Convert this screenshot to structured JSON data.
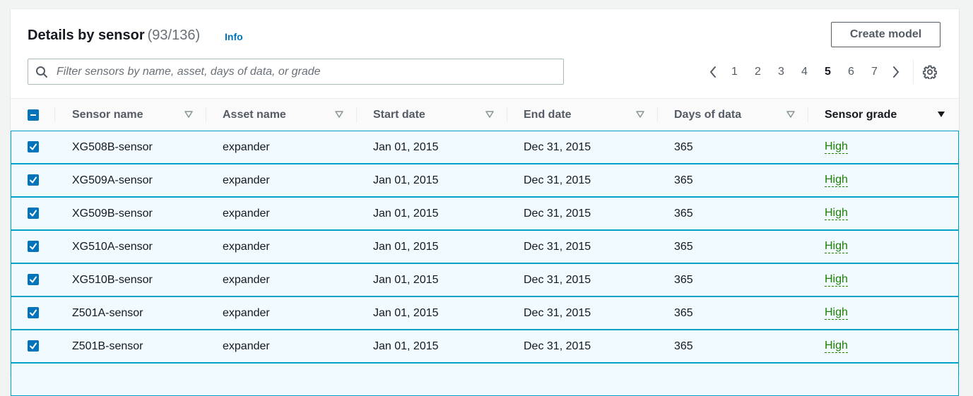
{
  "panel": {
    "title": "Details by sensor",
    "count": "(93/136)",
    "info_link": "Info",
    "create_button": "Create model"
  },
  "search": {
    "placeholder": "Filter sensors by name, asset, days of data, or grade"
  },
  "pagination": {
    "pages": [
      "1",
      "2",
      "3",
      "4",
      "5",
      "6",
      "7"
    ],
    "current_page": "5"
  },
  "table": {
    "columns": [
      "Sensor name",
      "Asset name",
      "Start date",
      "End date",
      "Days of data",
      "Sensor grade"
    ],
    "sorted_column": "Sensor grade",
    "rows": [
      {
        "sensor": "XG508B-sensor",
        "asset": "expander",
        "start": "Jan 01, 2015",
        "end": "Dec 31, 2015",
        "days": "365",
        "grade": "High"
      },
      {
        "sensor": "XG509A-sensor",
        "asset": "expander",
        "start": "Jan 01, 2015",
        "end": "Dec 31, 2015",
        "days": "365",
        "grade": "High"
      },
      {
        "sensor": "XG509B-sensor",
        "asset": "expander",
        "start": "Jan 01, 2015",
        "end": "Dec 31, 2015",
        "days": "365",
        "grade": "High"
      },
      {
        "sensor": "XG510A-sensor",
        "asset": "expander",
        "start": "Jan 01, 2015",
        "end": "Dec 31, 2015",
        "days": "365",
        "grade": "High"
      },
      {
        "sensor": "XG510B-sensor",
        "asset": "expander",
        "start": "Jan 01, 2015",
        "end": "Dec 31, 2015",
        "days": "365",
        "grade": "High"
      },
      {
        "sensor": "Z501A-sensor",
        "asset": "expander",
        "start": "Jan 01, 2015",
        "end": "Dec 31, 2015",
        "days": "365",
        "grade": "High"
      },
      {
        "sensor": "Z501B-sensor",
        "asset": "expander",
        "start": "Jan 01, 2015",
        "end": "Dec 31, 2015",
        "days": "365",
        "grade": "High"
      }
    ]
  },
  "colors": {
    "accent": "#0073bb",
    "selected_row_bg": "#f1faff",
    "selected_row_border": "#00a1c9",
    "grade_high": "#1d8102"
  }
}
